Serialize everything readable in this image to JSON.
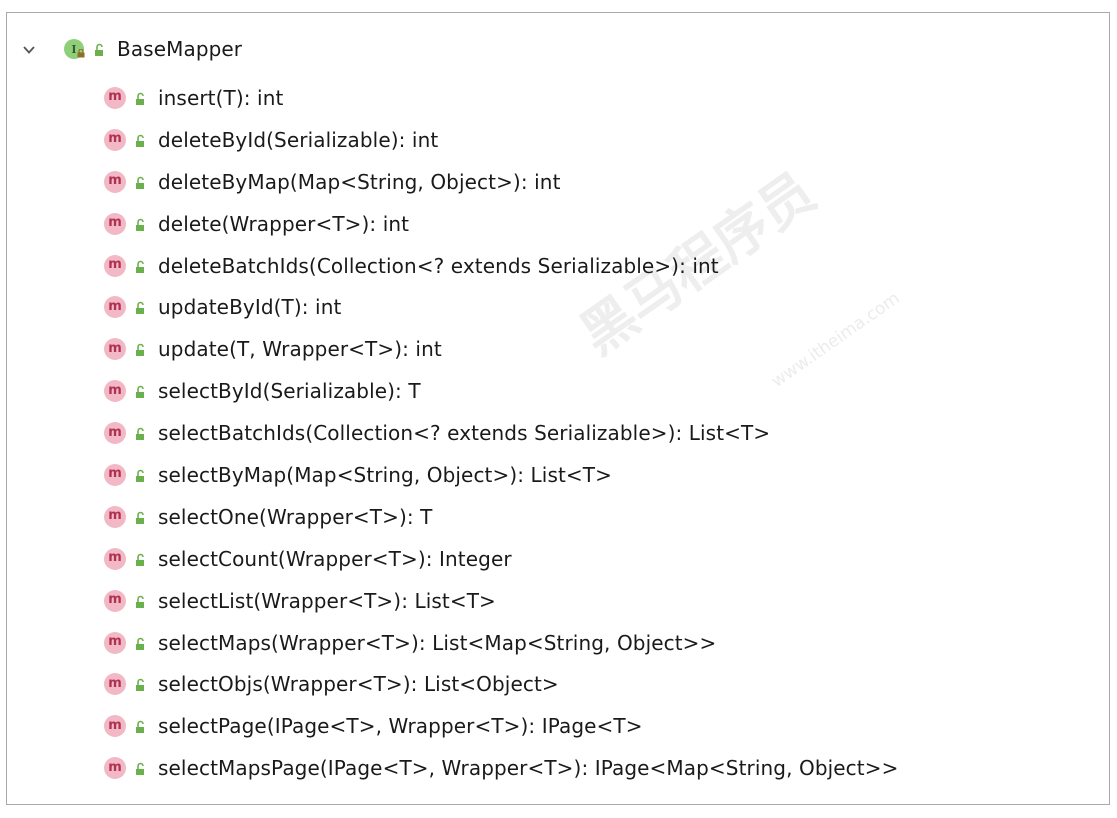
{
  "tree": {
    "root": {
      "label": "BaseMapper",
      "icon": "interface-icon",
      "expanded": true,
      "badge_letter": "I"
    },
    "method_icon_letter": "m",
    "methods": [
      "insert(T): int",
      "deleteById(Serializable): int",
      "deleteByMap(Map<String, Object>): int",
      "delete(Wrapper<T>): int",
      "deleteBatchIds(Collection<? extends Serializable>): int",
      "updateById(T): int",
      "update(T, Wrapper<T>): int",
      "selectById(Serializable): T",
      "selectBatchIds(Collection<? extends Serializable>): List<T>",
      "selectByMap(Map<String, Object>): List<T>",
      "selectOne(Wrapper<T>): T",
      "selectCount(Wrapper<T>): Integer",
      "selectList(Wrapper<T>): List<T>",
      "selectMaps(Wrapper<T>): List<Map<String, Object>>",
      "selectObjs(Wrapper<T>): List<Object>",
      "selectPage(IPage<T>, Wrapper<T>): IPage<T>",
      "selectMapsPage(IPage<T>, Wrapper<T>): IPage<Map<String, Object>>"
    ]
  },
  "watermark": {
    "main": "黑马程序员",
    "sub": "www.itheima.com"
  },
  "colors": {
    "interface_icon": "#8fcf7a",
    "method_icon": "#f2b8c6",
    "method_letter": "#b03050",
    "public_lock": "#6ab04c",
    "border": "#a9a9a9"
  }
}
